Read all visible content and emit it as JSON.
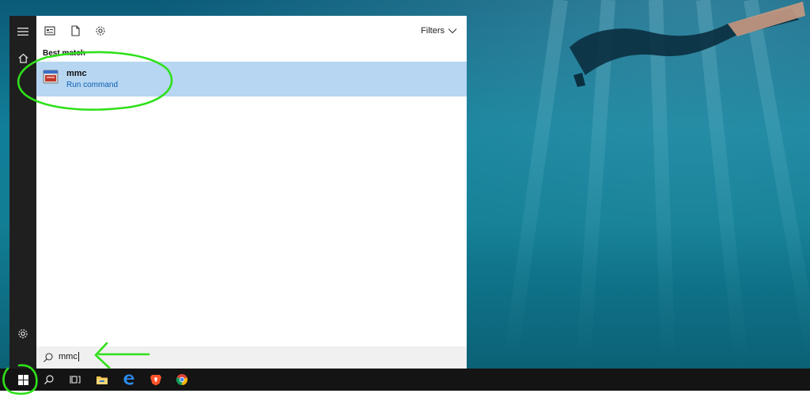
{
  "toolbar": {
    "filters_label": "Filters"
  },
  "results": {
    "section_title": "Best match",
    "best_match": {
      "name": "mmc",
      "subtitle": "Run command"
    }
  },
  "search": {
    "value": "mmc"
  },
  "rail": {
    "icons": [
      "hamburger-icon",
      "home-icon",
      "settings-icon"
    ]
  },
  "taskbar": {
    "icons": [
      "windows-start-icon",
      "search-icon",
      "task-view-icon",
      "file-explorer-icon",
      "edge-icon",
      "brave-icon",
      "chrome-icon"
    ]
  },
  "colors": {
    "selection": "#b7d6f2",
    "link_blue": "#0c5fb0",
    "annotation_green": "#2fe01a",
    "taskbar": "#141414"
  }
}
